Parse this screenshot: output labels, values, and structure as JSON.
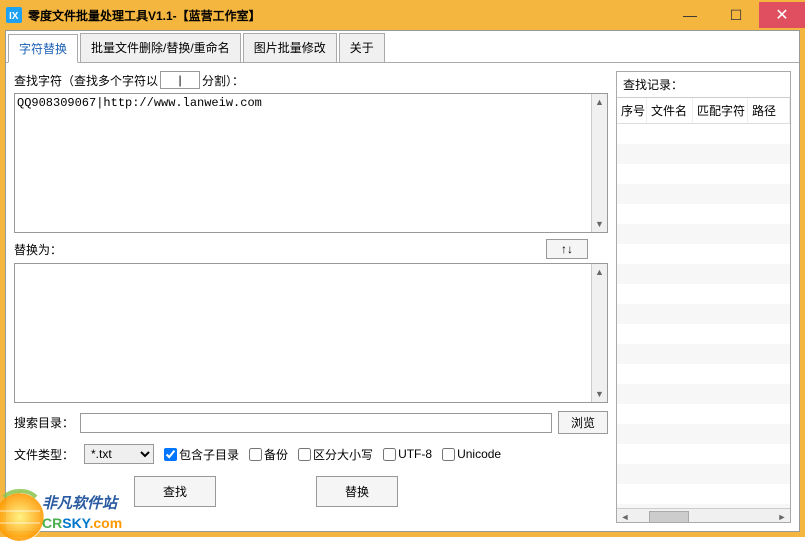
{
  "window": {
    "title": "零度文件批量处理工具V1.1-【蓝营工作室】"
  },
  "tabs": [
    {
      "label": "字符替换",
      "active": true
    },
    {
      "label": "批量文件删除/替换/重命名",
      "active": false
    },
    {
      "label": "图片批量修改",
      "active": false
    },
    {
      "label": "关于",
      "active": false
    }
  ],
  "find": {
    "label_prefix": "查找字符（查找多个字符以",
    "delimiter": "|",
    "label_suffix": "分割）：",
    "value": "QQ908309067|http://www.lanweiw.com"
  },
  "swap_button": "↑↓",
  "replace": {
    "label": "替换为：",
    "value": ""
  },
  "search_dir": {
    "label": "搜索目录：",
    "value": "",
    "browse": "浏览"
  },
  "filetype": {
    "label": "文件类型：",
    "selected": "*.txt"
  },
  "options": {
    "include_sub": {
      "label": "包含子目录",
      "checked": true
    },
    "backup": {
      "label": "备份",
      "checked": false
    },
    "case_sensitive": {
      "label": "区分大小写",
      "checked": false
    },
    "utf8": {
      "label": "UTF-8",
      "checked": false
    },
    "unicode": {
      "label": "Unicode",
      "checked": false
    }
  },
  "actions": {
    "find": "查找",
    "replace": "替换"
  },
  "results": {
    "title": "查找记录：",
    "columns": [
      "序号",
      "文件名",
      "匹配字符",
      "路径"
    ],
    "rows": []
  },
  "watermark": {
    "line1": "非凡软件站",
    "line2_parts": [
      "CR",
      "SKY",
      ".com"
    ]
  }
}
